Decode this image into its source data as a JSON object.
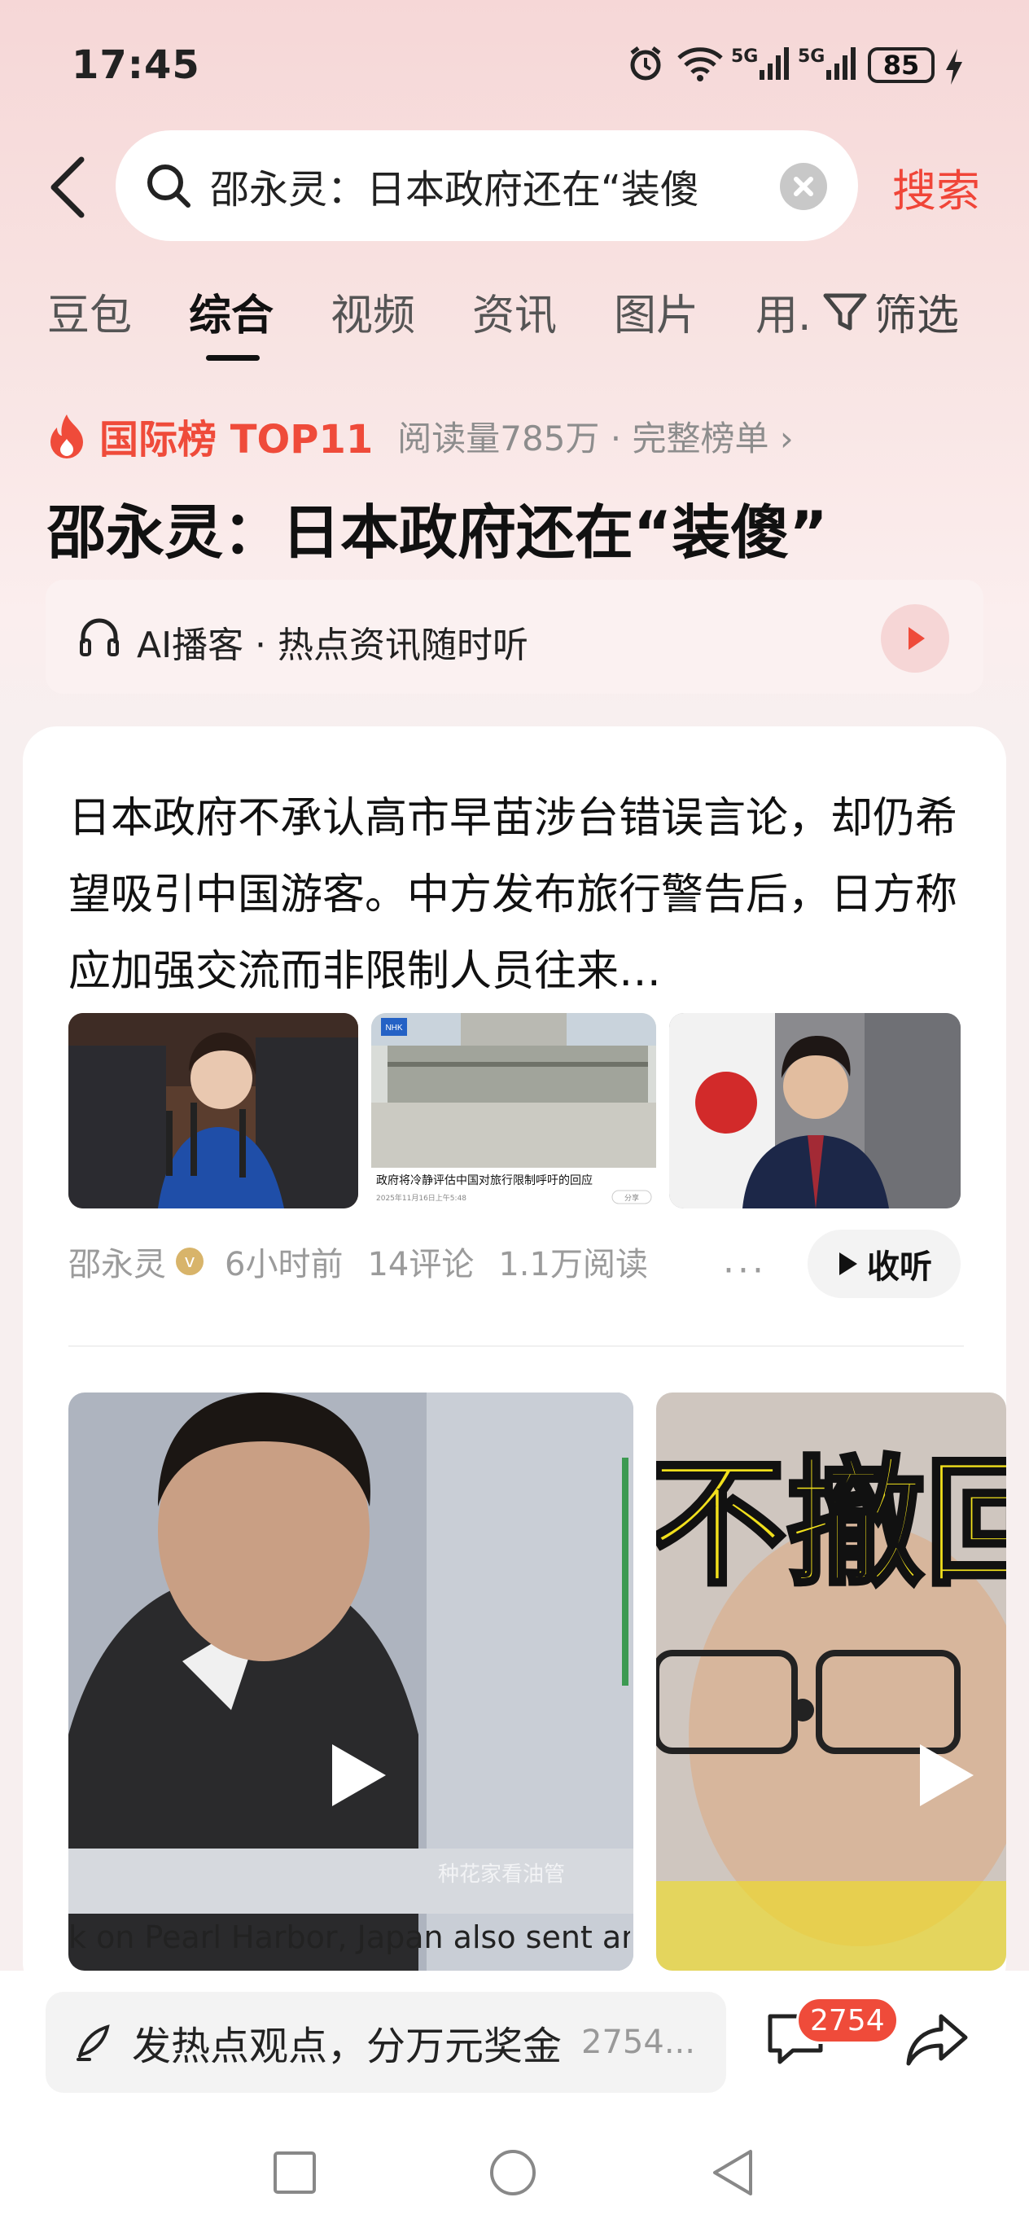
{
  "status_bar": {
    "time": "17:45",
    "network_1": "5G",
    "network_2": "5G",
    "battery": "85"
  },
  "search": {
    "query": "邵永灵：日本政府还在“装傻",
    "button_label": "搜索"
  },
  "tabs": [
    {
      "label": "豆包",
      "active": false
    },
    {
      "label": "综合",
      "active": true
    },
    {
      "label": "视频",
      "active": false
    },
    {
      "label": "资讯",
      "active": false
    },
    {
      "label": "图片",
      "active": false
    },
    {
      "label": "用...",
      "active": false
    }
  ],
  "filter_label": "筛选",
  "rank": {
    "label": "国际榜 TOP11",
    "meta": "阅读量785万 · 完整榜单 ›",
    "accent_color": "#ef4b3a"
  },
  "page_title": "邵永灵：日本政府还在“装傻”",
  "ai_podcast": {
    "label": "AI播客 · 热点资讯随时听"
  },
  "article": {
    "summary": "日本政府不承认高市早苗涉台错误言论，却仍希望吸引中国游客。中方发布旅行警告后，日方称应加强交流而非限制人员往来…",
    "thumbnails": [
      "speaker-at-microphones-photo",
      "nhk-news-building-photo",
      "official-at-podium-with-flag-photo"
    ],
    "thumb2_caption": "政府将冷静评估中国对旅行限制呼吁的回应",
    "thumb2_date": "2025年11月16日上午5:48",
    "thumb2_share": "分享",
    "author": "邵永灵",
    "time": "6小时前",
    "comments": "14评论",
    "reads": "1.1万阅读",
    "more": "···",
    "listen_label": "收听"
  },
  "videos": {
    "caption": "k on Pearl Harbor, Japan also sent an",
    "watermark": "种花家看油管",
    "overlay_text": "不撤回"
  },
  "comment_bar": {
    "placeholder": "发热点观点，分万元奖金",
    "count_inline": "2754...",
    "badge_count": "2754"
  }
}
